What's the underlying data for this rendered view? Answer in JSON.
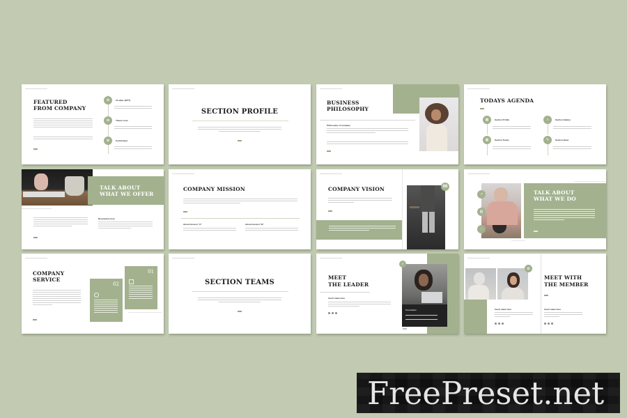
{
  "background_color": "#c2cbb2",
  "accent_color": "#a3b18e",
  "slides": [
    {
      "title_l1": "FEATURED",
      "title_l2": "FROM COMPANY",
      "items": [
        "10 ables (WTT)",
        "Theme color",
        "Social Input"
      ]
    },
    {
      "title": "SECTION PROFILE"
    },
    {
      "title_l1": "BUSINESS",
      "title_l2": "PHILOSOPHY",
      "subheading": "Philosophy of company"
    },
    {
      "title": "TODAYS AGENDA",
      "items": [
        "Section Profile",
        "Section Gallery",
        "Section Teams",
        "Section Ideas"
      ]
    },
    {
      "title_l1": "TALK ABOUT",
      "title_l2": "WHAT WE OFFER",
      "subheading": "Description here"
    },
    {
      "title": "COMPANY MISSION",
      "col_a": "About mission \"A\"",
      "col_b": "About mission \"B\""
    },
    {
      "title": "COMPANY VISION",
      "quote_icon": "66"
    },
    {
      "title_l1": "TALK ABOUT",
      "title_l2": "WHAT WE DO"
    },
    {
      "title_l1": "COMPANY",
      "title_l2": "SERVICE",
      "card_a_num": "02",
      "card_b_num": "01"
    },
    {
      "title": "SECTION TEAMS"
    },
    {
      "title_l1": "MEET",
      "title_l2": "THE LEADER",
      "name": "Insert name here",
      "panel_label": "Presentation"
    },
    {
      "title_l1": "MEET WITH",
      "title_l2": "THE MEMBER",
      "name_a": "Insert name here",
      "name_b": "Insert name here"
    }
  ],
  "watermark": "FreePreset.net"
}
